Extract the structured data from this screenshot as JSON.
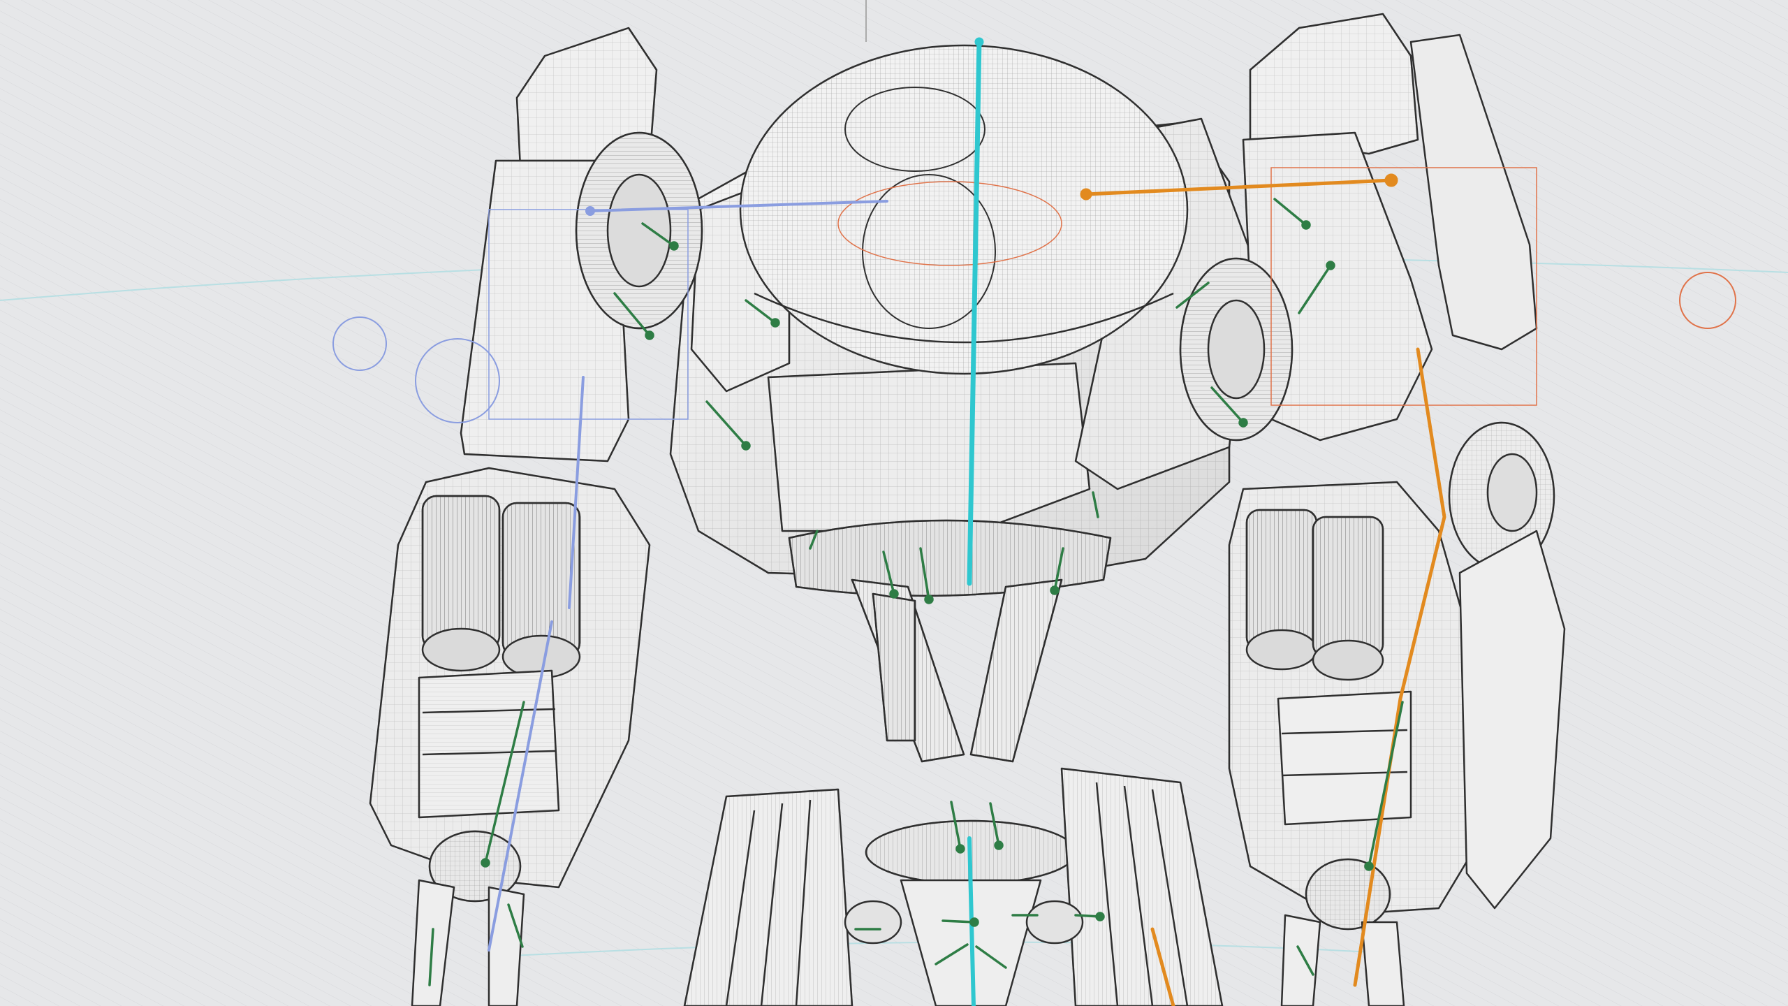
{
  "scene": {
    "view": "3d-viewport",
    "shading": "wireframe-on-shaded",
    "subject": "mech-robot",
    "background_color": "#e6e7e9",
    "mesh_fill_color": "#f1f1f1",
    "mesh_line_color": "#3a3a3a",
    "colors": {
      "spine_bone": "#2fc7cf",
      "right_arm_bones": "#e28a1f",
      "left_arm_bones": "#8a9de0",
      "joint_bones": "#2e7d45",
      "guide_circle_orange": "#e0734a",
      "guide_circle_blue": "#7b8fd6"
    }
  }
}
